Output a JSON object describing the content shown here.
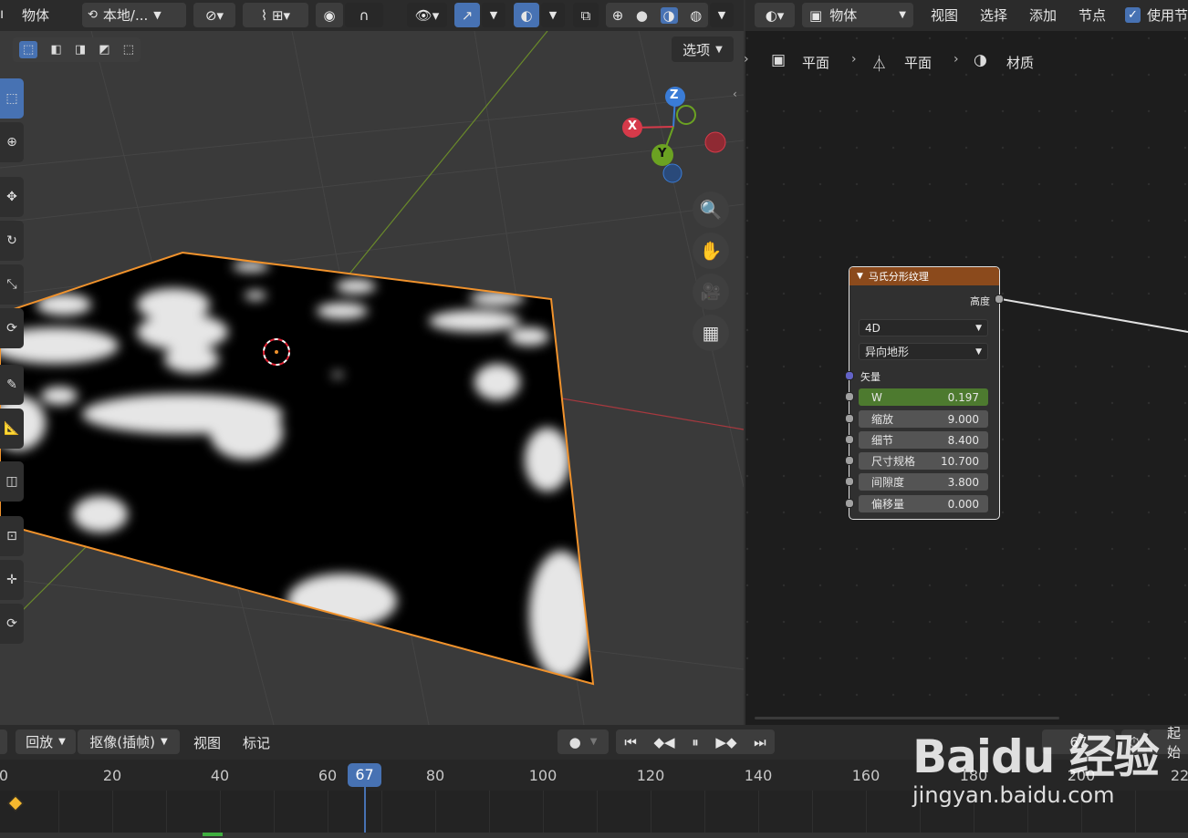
{
  "viewport_header": {
    "object_menu": "物体",
    "transform_orientation": "本地/...",
    "options_label": "选项"
  },
  "node_header": {
    "editor_type": "物体",
    "menus": [
      "视图",
      "选择",
      "添加",
      "节点"
    ],
    "use_nodes": "使用节"
  },
  "breadcrumb": [
    {
      "icon": "object-icon",
      "label": "平面"
    },
    {
      "icon": "mesh-icon",
      "label": "平面"
    },
    {
      "icon": "material-icon",
      "label": "材质"
    }
  ],
  "node": {
    "title": "马氏分形纹理",
    "output": "高度",
    "dimension": "4D",
    "type": "异向地形",
    "vector_label": "矢量",
    "fields": [
      {
        "label": "W",
        "value": "0.197"
      },
      {
        "label": "缩放",
        "value": "9.000"
      },
      {
        "label": "细节",
        "value": "8.400"
      },
      {
        "label": "尺寸规格",
        "value": "10.700"
      },
      {
        "label": "间隙度",
        "value": "3.800"
      },
      {
        "label": "偏移量",
        "value": "0.000"
      }
    ]
  },
  "gizmo": {
    "x": "X",
    "y": "Y",
    "z": "Z"
  },
  "timeline": {
    "playback": "回放",
    "keying": "抠像(插帧)",
    "view": "视图",
    "marker": "标记",
    "current_frame": "67",
    "start_label": "起始",
    "ticks": [
      "0",
      "20",
      "40",
      "60",
      "80",
      "100",
      "120",
      "140",
      "160",
      "180",
      "200",
      "22"
    ],
    "playhead": "67"
  },
  "watermark": {
    "brand": "Baidu 经验",
    "url": "jingyan.baidu.com"
  },
  "colors": {
    "accent": "#4772b3",
    "selected_outline": "#f0922c",
    "node_header": "#8b4a1c",
    "w_field": "#4d7a2f"
  }
}
